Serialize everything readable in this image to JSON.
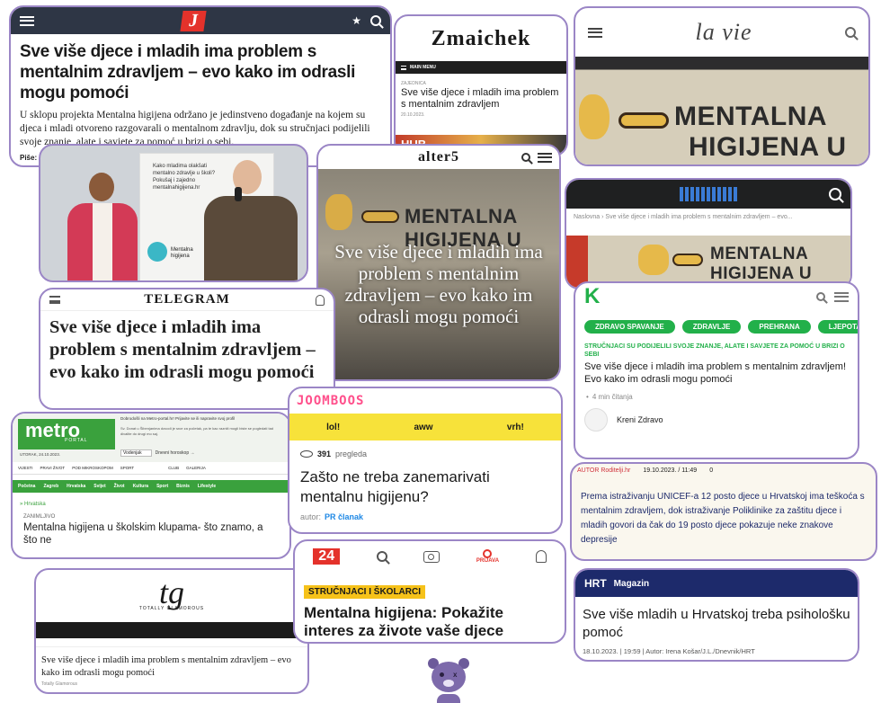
{
  "jutarnji": {
    "logo": "J",
    "headline": "Sve više djece i mladih ima problem s mentalnim zdravljem – evo kako im odrasli mogu pomoći",
    "body": "U sklopu projekta Mentalna higijena održano je jedinstveno događanje na kojem su djeca i mladi otvoreno razgovarali o mentalnom zdravlju, dok su stručnjaci podijelili svoje znanje, alate i savjete za pomoć u brizi o sebi.",
    "author_label": "Piše:",
    "brand_color": "#e4322b"
  },
  "zmaichek": {
    "logo": "Zmaichek",
    "menu": "MAIN MENU",
    "category": "ZAJEDNICA",
    "headline": "Sve više djece i mladih ima problem s mentalnim zdravljem",
    "date": "20.10.2023.",
    "banner": "HUB"
  },
  "lavie": {
    "logo": "la vie",
    "wall_line1": "MENTALNA",
    "wall_line2": "HIGIJENA U"
  },
  "photo": {
    "poster_text": "Kako mladima olakšati mentalno zdravlje u školi? Pokušaj i zajedno mentalnahigijena.hr",
    "poster_logo": "Mentalna higijena"
  },
  "alter5": {
    "logo": "alter5",
    "wall_line1": "MENTALNA",
    "wall_line2": "HIGIJENA U",
    "overlay": "Sve više djece i mladih ima problem s mentalnim zdravljem – evo kako im odrasli mogu pomoći"
  },
  "site_dark": {
    "breadcrumb": "Naslovna  ›  Sve više djece i mladih ima problem s mentalnim zdravljem – evo...",
    "wall_line1": "MENTALNA",
    "wall_line2": "HIGIJENA U"
  },
  "telegram": {
    "logo": "TELEGRAM",
    "headline": "Sve više djece i mladih ima problem s mentalnim zdravljem – evo kako im odrasli mogu pomoći"
  },
  "kreni": {
    "logo": "K",
    "tabs": [
      "ZDRAVO SPAVANJE",
      "ZDRAVLJE",
      "PREHRANA",
      "LJEPOTA"
    ],
    "kicker": "STRUČNJACI SU PODIJELILI SVOJE ZNANJE, ALATE I SAVJETE ZA POMOĆ U BRIZI O SEBI",
    "headline": "Sve više djece i mladih ima problem s mentalnim zdravljem! Evo kako im odrasli mogu pomoći",
    "read_time": "4 min čitanja",
    "author": "Kreni Zdravo",
    "accent": "#22b04a"
  },
  "metro": {
    "logo": "metro",
    "logo_sub": "PORTAL",
    "top_text": "Dobrodošli na Metro-portal.hr! Prijavite se ili napravite svoj profil",
    "info_text": "Sv. Donat u Šibenjanima dovodi je srce za početak, pa te kao razniti mogli biste se pogledati tad divalite do drugi mo saj.",
    "date": "UTORAK, 24.10.2023.",
    "nav": [
      "Početna",
      "Zagreb",
      "Hrvatska",
      "Svijet",
      "Život",
      "Kultura",
      "Sport",
      "Biznis",
      "Lifestyle"
    ],
    "subnav": [
      "VIJESTI",
      "PRAVI ŽIVOT",
      "POD MIKROSKOPOM",
      "SPORT",
      "CLUB",
      "GALERIJA"
    ],
    "select": "Vodenjak",
    "select_link": "Dnevni horoskop →",
    "breadcrumb": "» Hrvatska",
    "category": "ZANIMLJIVO",
    "headline": "Mentalna higijena u školskim klupama- što znamo, a što ne",
    "accent": "#3aa13d"
  },
  "joomboos": {
    "logo": "JOOMBOOS",
    "tabs": [
      "lol!",
      "aww",
      "vrh!"
    ],
    "views": "391",
    "views_label": "pregleda",
    "headline": "Zašto ne treba zanemarivati mentalnu higijenu?",
    "author_label": "autor:",
    "author": "PR članak",
    "accent": "#f7e23a"
  },
  "roditelji": {
    "author": "AUTOR Roditelji.hr",
    "date": "19.10.2023. / 11:49",
    "comments": "0",
    "body": "Prema istraživanju UNICEF-a 12 posto djece u Hrvatskoj ima teškoća s mentalnim zdravljem, dok istraživanje Poliklinike za zaštitu djece i mladih govori da čak do 19 posto djece pokazuje neke znakove depresije"
  },
  "tg": {
    "logo": "tg",
    "logo_sub": "TOTALLY GLAMOROUS",
    "headline": "Sve više djece i mladih ima problem s mentalnim zdravljem – evo kako im odrasli mogu pomoći",
    "author": "Totally Glamorous"
  },
  "net24": {
    "logo": "24",
    "login": "PRIJAVA",
    "category": "STRUČNJACI I ŠKOLARCI",
    "headline": "Mentalna higijena: Pokažite interes za živote vaše djece",
    "accent": "#f6c21a"
  },
  "hrt": {
    "logo": "HRT",
    "section": "Magazin",
    "headline": "Sve više mladih u Hrvatskoj treba psihološku pomoć",
    "meta": "18.10.2023. | 19:59 | Autor: Irena Košar/J.L./Dnevnik/HRT",
    "brand": "#1d2a6b"
  },
  "mascot": {
    "name": "bear-mascot"
  },
  "colors": {
    "frame": "#9b86c6",
    "bg": "#ffffff"
  }
}
